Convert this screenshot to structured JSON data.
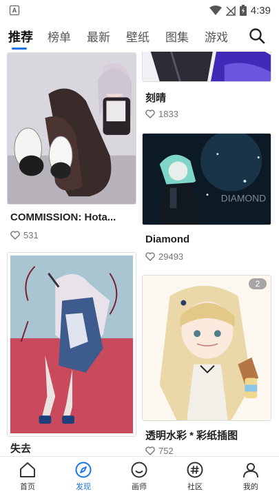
{
  "status_bar": {
    "time": "4:39",
    "app_badge": "A"
  },
  "tabs": [
    {
      "label": "推荐",
      "active": true
    },
    {
      "label": "榜单",
      "active": false
    },
    {
      "label": "最新",
      "active": false
    },
    {
      "label": "壁纸",
      "active": false
    },
    {
      "label": "图集",
      "active": false
    },
    {
      "label": "游戏",
      "active": false
    }
  ],
  "feed": {
    "cards": [
      {
        "title": "",
        "likes": ""
      },
      {
        "title": "刻晴",
        "likes": "1833"
      },
      {
        "title": "COMMISSION: Hota...",
        "likes": "531"
      },
      {
        "title": "Diamond",
        "likes": "29493"
      },
      {
        "title": "失去",
        "likes": ""
      },
      {
        "title": "透明水彩 * 彩纸插图",
        "likes": "752",
        "badge": "2"
      }
    ]
  },
  "bottom_nav": [
    {
      "label": "首页",
      "icon": "home-icon",
      "active": false
    },
    {
      "label": "发现",
      "icon": "compass-icon",
      "active": true
    },
    {
      "label": "画师",
      "icon": "smiley-icon",
      "active": false
    },
    {
      "label": "社区",
      "icon": "hash-icon",
      "active": false
    },
    {
      "label": "我的",
      "icon": "person-icon",
      "active": false
    }
  ],
  "colors": {
    "accent": "#1a73e8",
    "text": "#222222",
    "muted": "#777777"
  }
}
